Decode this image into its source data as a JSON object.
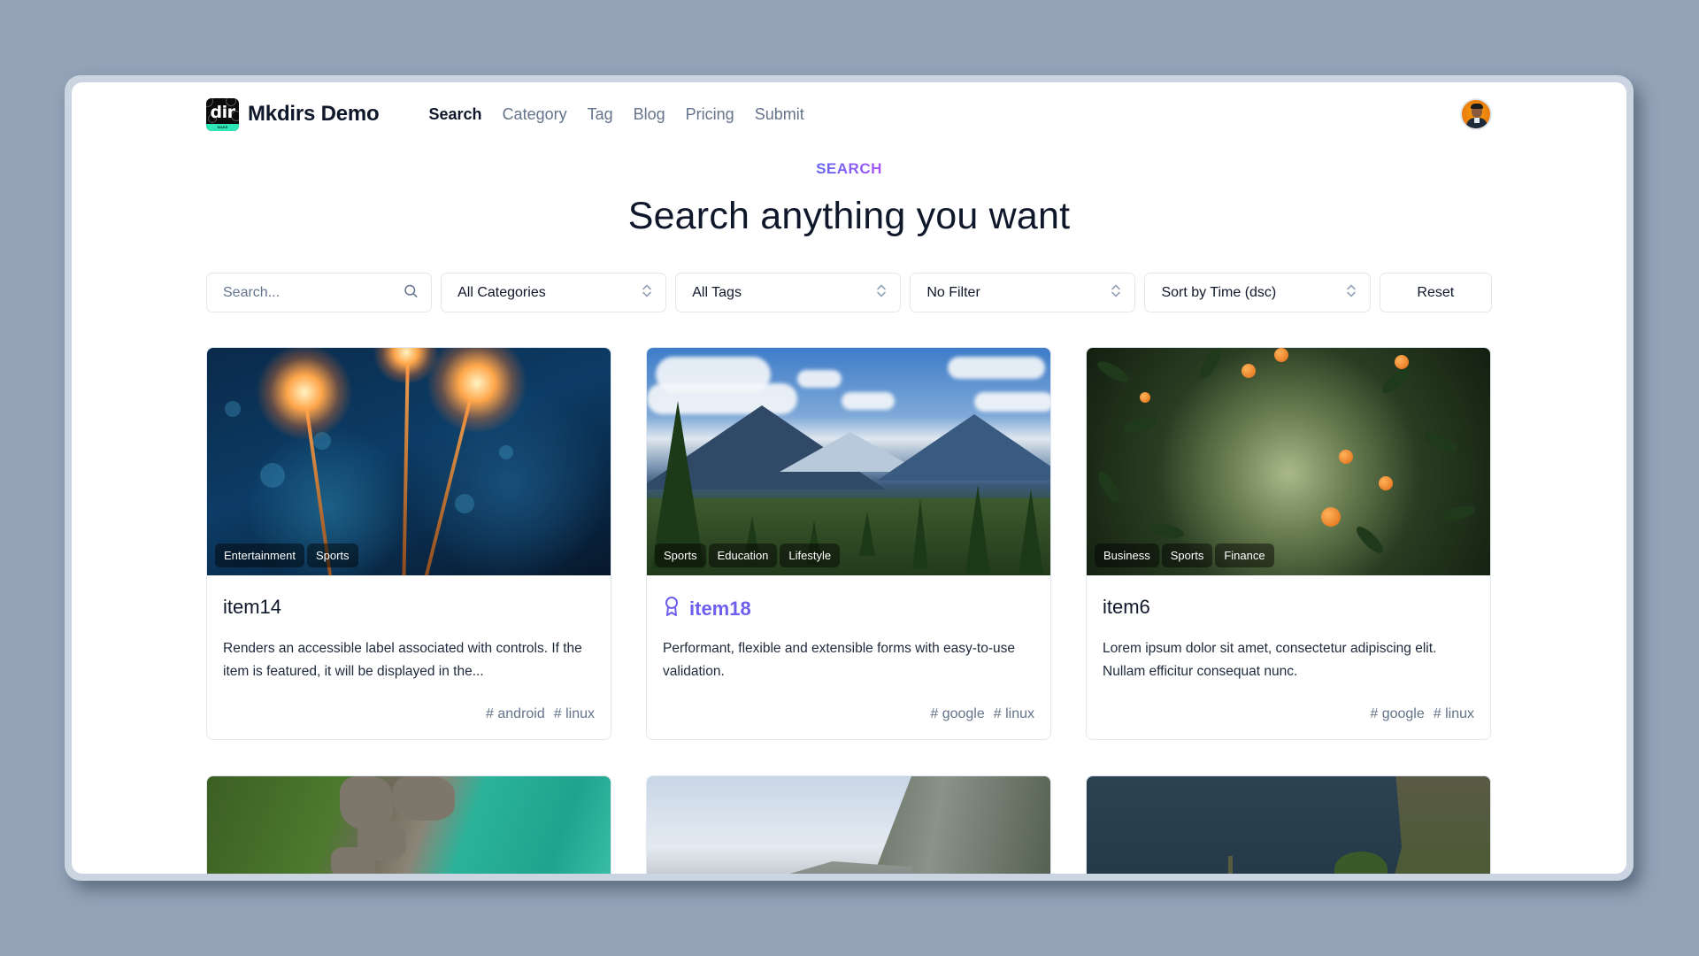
{
  "app": {
    "brand_name": "Mkdirs Demo",
    "logo_text": "dir",
    "logo_subtext": "MAKE"
  },
  "nav": {
    "items": [
      {
        "label": "Search",
        "active": true
      },
      {
        "label": "Category",
        "active": false
      },
      {
        "label": "Tag",
        "active": false
      },
      {
        "label": "Blog",
        "active": false
      },
      {
        "label": "Pricing",
        "active": false
      },
      {
        "label": "Submit",
        "active": false
      }
    ]
  },
  "user": {
    "avatar": "user-avatar"
  },
  "hero": {
    "eyebrow": "SEARCH",
    "title": "Search anything you want"
  },
  "filters": {
    "search_placeholder": "Search...",
    "search_value": "",
    "category": "All Categories",
    "tags": "All Tags",
    "filter": "No Filter",
    "sort": "Sort by Time (dsc)",
    "reset_label": "Reset"
  },
  "colors": {
    "accent": "#6d5ef0",
    "eyebrow_gradient": [
      "#6366f1",
      "#a855f7"
    ],
    "background": "#94a3b8",
    "tag_text": "#64748b"
  },
  "items": [
    {
      "name": "item14",
      "featured": false,
      "categories": [
        "Entertainment",
        "Sports"
      ],
      "description": "Renders an accessible label associated with controls. If the item is featured, it will be displayed in the...",
      "tags": [
        "android",
        "linux"
      ],
      "image": "sparklers"
    },
    {
      "name": "item18",
      "featured": true,
      "categories": [
        "Sports",
        "Education",
        "Lifestyle"
      ],
      "description": "Performant, flexible and extensible forms with easy-to-use validation.",
      "tags": [
        "google",
        "linux"
      ],
      "image": "mountains"
    },
    {
      "name": "item6",
      "featured": false,
      "categories": [
        "Business",
        "Sports",
        "Finance"
      ],
      "description": "Lorem ipsum dolor sit amet, consectetur adipiscing elit. Nullam efficitur consequat nunc.",
      "tags": [
        "google",
        "linux"
      ],
      "image": "oranges"
    },
    {
      "image": "coast"
    },
    {
      "image": "cliff"
    },
    {
      "image": "sea-cliff"
    }
  ]
}
